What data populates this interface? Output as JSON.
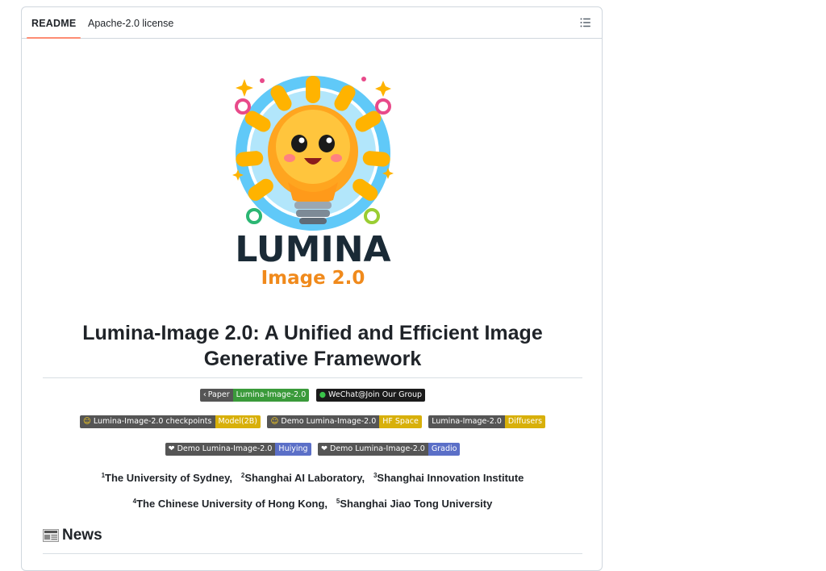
{
  "tabs": [
    {
      "label": "README",
      "active": true
    },
    {
      "label": "Apache-2.0 license",
      "active": false
    }
  ],
  "toc_icon": "list-unordered-icon",
  "logo": {
    "word": "LUMINA",
    "sub": "Image 2.0"
  },
  "title": "Lumina-Image 2.0: A Unified and Efficient Image Generative Framework",
  "badges": {
    "paper": {
      "left": "Paper",
      "right": "Lumina-Image-2.0"
    },
    "wechat": {
      "left": "WeChat@Join Our Group"
    },
    "checkpoints": {
      "left": "Lumina-Image-2.0 checkpoints",
      "right": "Model(2B)"
    },
    "hf_demo": {
      "left": "Demo Lumina-Image-2.0",
      "right": "HF Space"
    },
    "diffusers": {
      "left": "Lumina-Image-2.0",
      "right": "Diffusers"
    },
    "huiying": {
      "left": "Demo Lumina-Image-2.0",
      "right": "Huiying"
    },
    "gradio": {
      "left": "Demo Lumina-Image-2.0",
      "right": "Gradio"
    }
  },
  "affiliations": {
    "line1": [
      {
        "sup": "1",
        "name": "The University of Sydney,"
      },
      {
        "sup": "2",
        "name": "Shanghai AI Laboratory,"
      },
      {
        "sup": "3",
        "name": "Shanghai Innovation Institute"
      }
    ],
    "line2": [
      {
        "sup": "4",
        "name": "The Chinese University of Hong Kong,"
      },
      {
        "sup": "5",
        "name": "Shanghai Jiao Tong University"
      }
    ]
  },
  "news_heading": "News",
  "colors": {
    "tab_underline": "#fd8c73",
    "badge_left": "#555555",
    "badge_green": "#3a9a3a",
    "badge_yellow": "#d8b00a",
    "badge_blue": "#5b6fc7",
    "logo_text": "#1a2a36",
    "logo_sub": "#f08a1c"
  }
}
